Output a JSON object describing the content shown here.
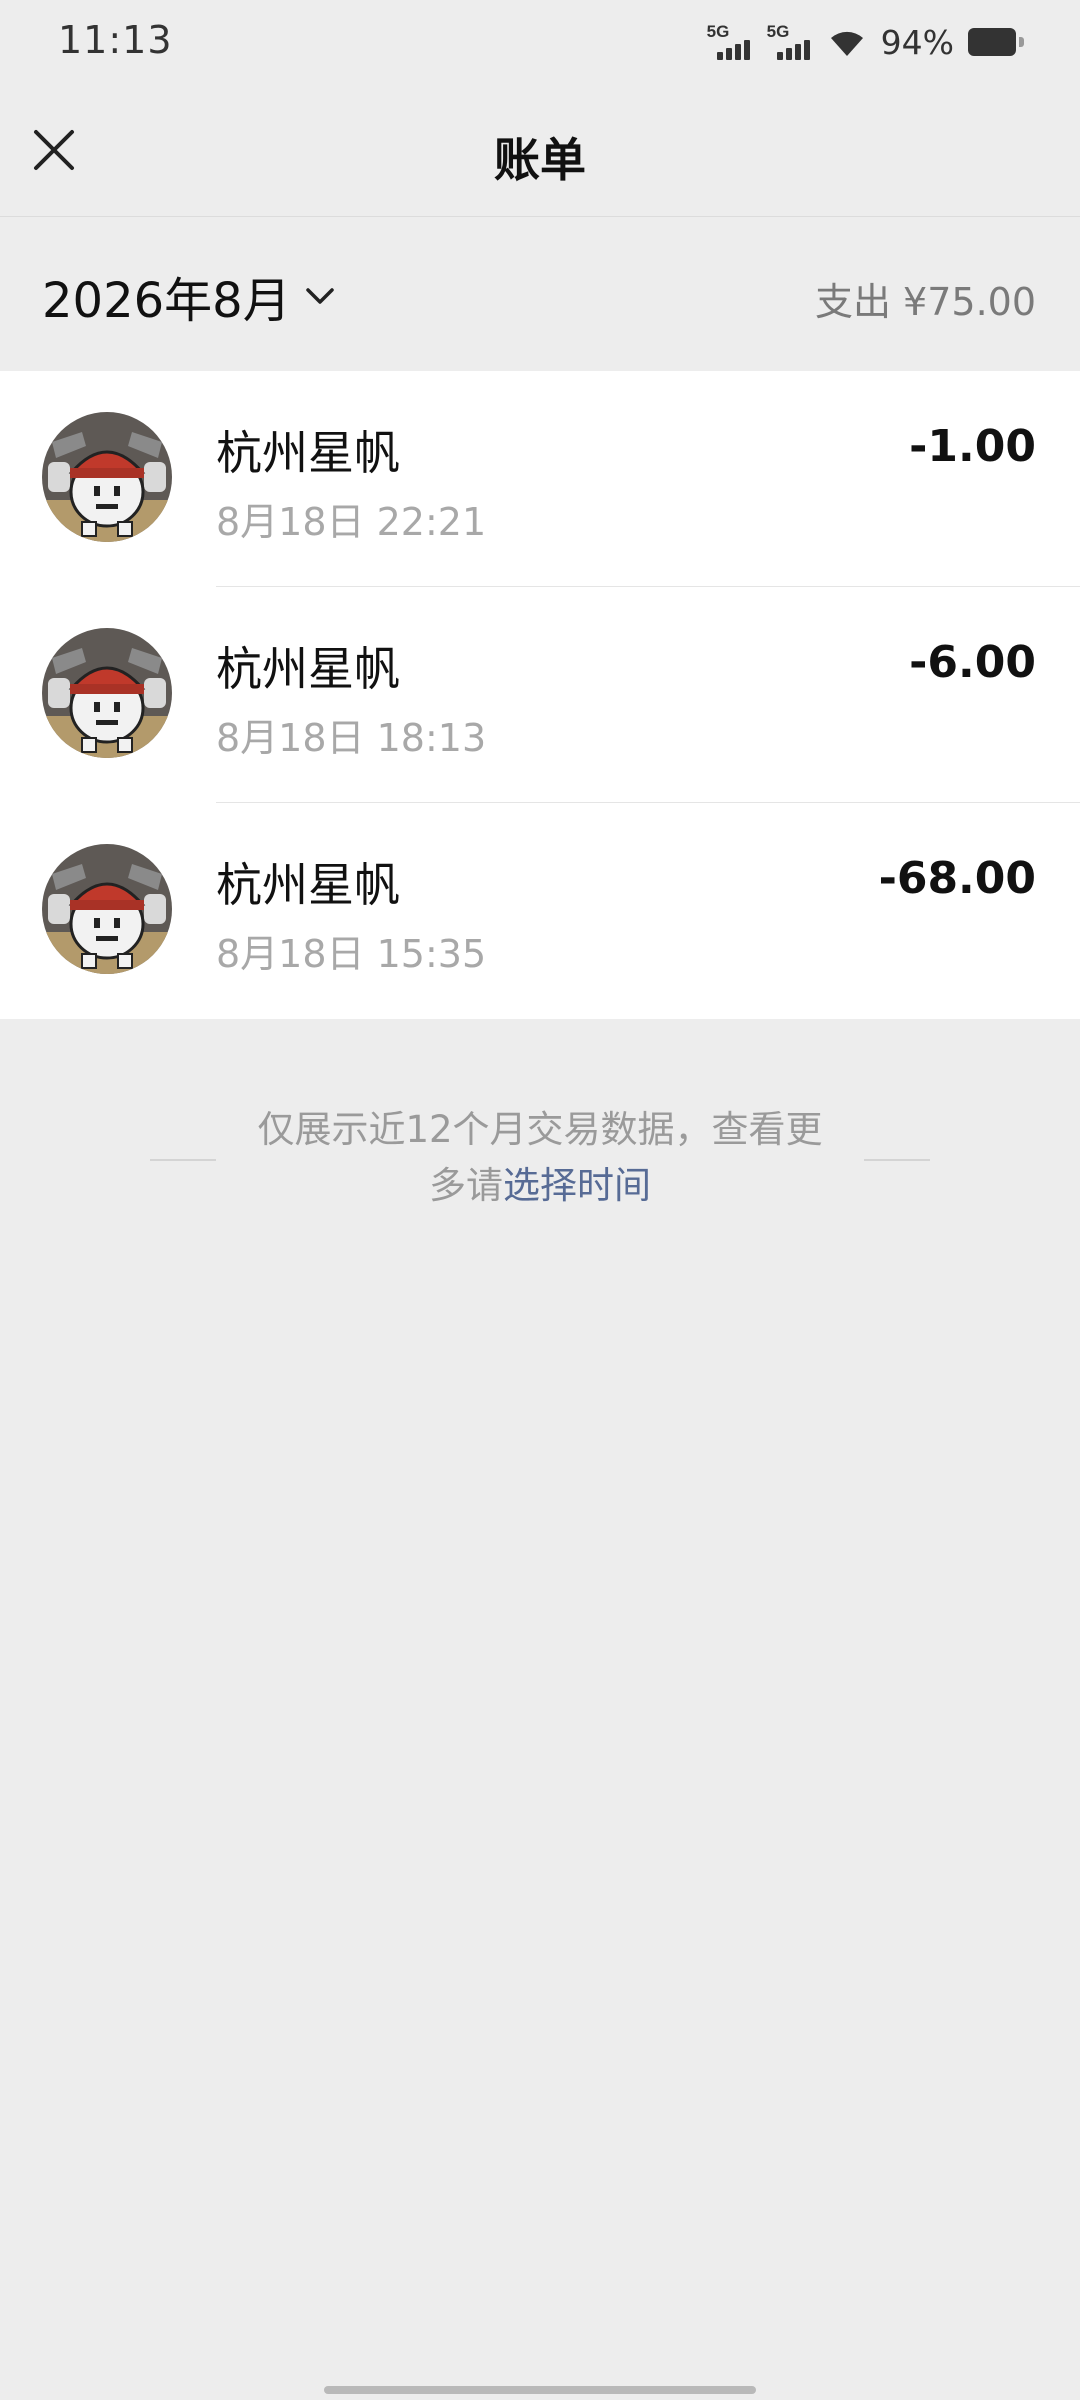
{
  "status_bar": {
    "time": "11:13",
    "network_1": "5G",
    "network_2": "5G",
    "battery_percent": "94%",
    "battery_level": 0.94,
    "icons": [
      "signal-5g-icon",
      "signal-5g-icon",
      "wifi-icon",
      "battery-icon"
    ]
  },
  "nav": {
    "title": "账单",
    "close_icon": "close-icon"
  },
  "month_header": {
    "month": "2026年8月",
    "chevron_icon": "chevron-down-icon",
    "summary": "支出 ¥75.00"
  },
  "transactions": [
    {
      "merchant": "杭州星帆",
      "datetime": "8月18日 22:21",
      "amount": "-1.00"
    },
    {
      "merchant": "杭州星帆",
      "datetime": "8月18日 18:13",
      "amount": "-6.00"
    },
    {
      "merchant": "杭州星帆",
      "datetime": "8月18日 15:35",
      "amount": "-68.00"
    }
  ],
  "footer": {
    "note_prefix": "仅展示近12个月交易数据，查看更多请",
    "note_link": "选择时间"
  },
  "colors": {
    "background": "#ededed",
    "card": "#ffffff",
    "link": "#576b95",
    "secondary_text": "#a8a8a8"
  }
}
